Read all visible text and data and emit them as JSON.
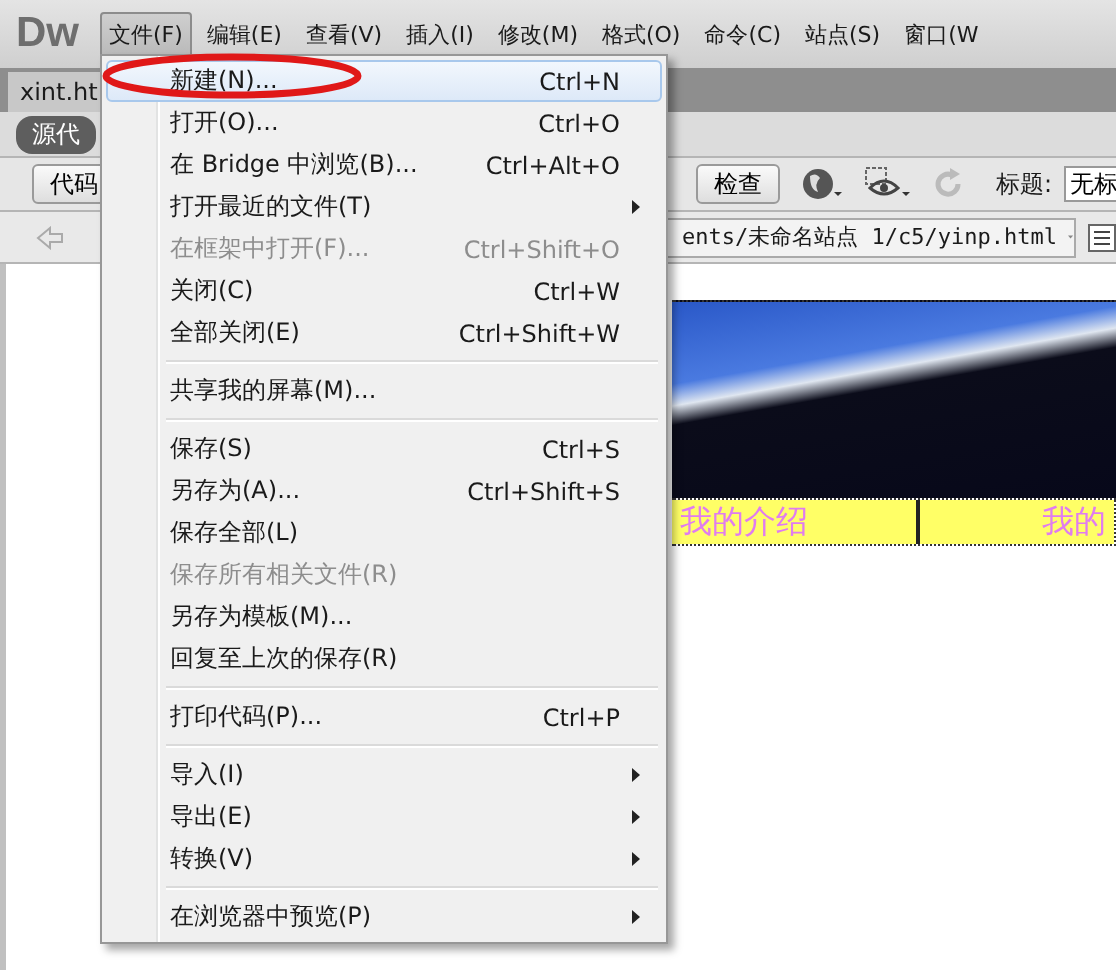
{
  "logo": "Dw",
  "menubar": [
    {
      "label": "文件(F)",
      "selected": true
    },
    {
      "label": "编辑(E)",
      "selected": false
    },
    {
      "label": "查看(V)",
      "selected": false
    },
    {
      "label": "插入(I)",
      "selected": false
    },
    {
      "label": "修改(M)",
      "selected": false
    },
    {
      "label": "格式(O)",
      "selected": false
    },
    {
      "label": "命令(C)",
      "selected": false
    },
    {
      "label": "站点(S)",
      "selected": false
    },
    {
      "label": "窗口(W",
      "selected": false
    }
  ],
  "document_tab": {
    "label": "xint.ht"
  },
  "view_switch": {
    "label": "源代",
    "selected": true
  },
  "toolbar": {
    "code_button": "代码",
    "inspect_button": "检查",
    "title_label": "标题:",
    "title_value": "无标"
  },
  "address_bar": {
    "value": "ents/未命名站点 1/c5/yinp.html"
  },
  "page": {
    "cells": [
      "我的介绍",
      "我的"
    ]
  },
  "file_menu": [
    {
      "kind": "item",
      "label": "新建(N)...",
      "shortcut": "Ctrl+N",
      "disabled": false,
      "submenu": false,
      "selected": true
    },
    {
      "kind": "item",
      "label": "打开(O)...",
      "shortcut": "Ctrl+O",
      "disabled": false,
      "submenu": false,
      "selected": false
    },
    {
      "kind": "item",
      "label": "在 Bridge 中浏览(B)...",
      "shortcut": "Ctrl+Alt+O",
      "disabled": false,
      "submenu": false,
      "selected": false
    },
    {
      "kind": "item",
      "label": "打开最近的文件(T)",
      "disabled": false,
      "submenu": true,
      "selected": false
    },
    {
      "kind": "item",
      "label": "在框架中打开(F)...",
      "shortcut": "Ctrl+Shift+O",
      "disabled": true,
      "submenu": false,
      "selected": false
    },
    {
      "kind": "item",
      "label": "关闭(C)",
      "shortcut": "Ctrl+W",
      "disabled": false,
      "submenu": false,
      "selected": false
    },
    {
      "kind": "item",
      "label": "全部关闭(E)",
      "shortcut": "Ctrl+Shift+W",
      "disabled": false,
      "submenu": false,
      "selected": false
    },
    {
      "kind": "separator"
    },
    {
      "kind": "item",
      "label": "共享我的屏幕(M)...",
      "disabled": false,
      "submenu": false,
      "selected": false
    },
    {
      "kind": "separator"
    },
    {
      "kind": "item",
      "label": "保存(S)",
      "shortcut": "Ctrl+S",
      "disabled": false,
      "submenu": false,
      "selected": false
    },
    {
      "kind": "item",
      "label": "另存为(A)...",
      "shortcut": "Ctrl+Shift+S",
      "disabled": false,
      "submenu": false,
      "selected": false
    },
    {
      "kind": "item",
      "label": "保存全部(L)",
      "disabled": false,
      "submenu": false,
      "selected": false
    },
    {
      "kind": "item",
      "label": "保存所有相关文件(R)",
      "disabled": true,
      "submenu": false,
      "selected": false
    },
    {
      "kind": "item",
      "label": "另存为模板(M)...",
      "disabled": false,
      "submenu": false,
      "selected": false
    },
    {
      "kind": "item",
      "label": "回复至上次的保存(R)",
      "disabled": false,
      "submenu": false,
      "selected": false
    },
    {
      "kind": "separator"
    },
    {
      "kind": "item",
      "label": "打印代码(P)...",
      "shortcut": "Ctrl+P",
      "disabled": false,
      "submenu": false,
      "selected": false
    },
    {
      "kind": "separator"
    },
    {
      "kind": "item",
      "label": "导入(I)",
      "disabled": false,
      "submenu": true,
      "selected": false
    },
    {
      "kind": "item",
      "label": "导出(E)",
      "disabled": false,
      "submenu": true,
      "selected": false
    },
    {
      "kind": "item",
      "label": "转换(V)",
      "disabled": false,
      "submenu": true,
      "selected": false
    },
    {
      "kind": "separator"
    },
    {
      "kind": "item",
      "label": "在浏览器中预览(P)",
      "disabled": false,
      "submenu": true,
      "selected": false
    }
  ]
}
